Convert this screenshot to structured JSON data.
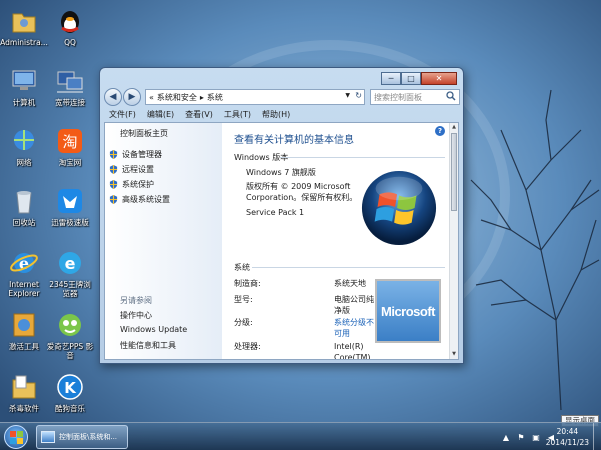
{
  "desktop": {
    "icons": [
      {
        "label": "Administra...",
        "icon": "user-folder-icon"
      },
      {
        "label": "QQ",
        "icon": "qq-penguin-icon"
      },
      {
        "label": "计算机",
        "icon": "computer-icon"
      },
      {
        "label": "宽带连接",
        "icon": "broadband-connection-icon"
      },
      {
        "label": "网络",
        "icon": "network-icon"
      },
      {
        "label": "淘宝网",
        "icon": "taobao-icon"
      },
      {
        "label": "回收站",
        "icon": "recycle-bin-icon"
      },
      {
        "label": "迅雷极速版",
        "icon": "xunlei-icon"
      },
      {
        "label": "Internet\nExplorer",
        "icon": "internet-explorer-icon"
      },
      {
        "label": "2345王牌浏\n览器",
        "icon": "browser-2345-icon"
      },
      {
        "label": "激活工具",
        "icon": "activation-tool-icon"
      },
      {
        "label": "爱奇艺PPS 影\n音",
        "icon": "iqiyi-pps-icon"
      },
      {
        "label": "杀毒软件",
        "icon": "antivirus-folder-icon"
      },
      {
        "label": "酷狗音乐",
        "icon": "kugou-music-icon"
      }
    ]
  },
  "window": {
    "caption_buttons": {
      "minimize": "─",
      "maximize": "□",
      "close": "✕"
    },
    "nav": {
      "back": "◀",
      "forward": "▶"
    },
    "address": {
      "prefix": "«",
      "crumb1": "系统和安全",
      "sep": "▸",
      "crumb2": "系统",
      "dropdown": "▼",
      "refresh": "↻"
    },
    "search_placeholder": "搜索控制面板",
    "menu": [
      "文件(F)",
      "编辑(E)",
      "查看(V)",
      "工具(T)",
      "帮助(H)"
    ],
    "left_panel": {
      "home": "控制面板主页",
      "tasks": [
        "设备管理器",
        "远程设置",
        "系统保护",
        "高级系统设置"
      ],
      "see_also_title": "另请参阅",
      "see_also": [
        "操作中心",
        "Windows Update",
        "性能信息和工具"
      ]
    },
    "main": {
      "help": "?",
      "title": "查看有关计算机的基本信息",
      "edition_header": "Windows 版本",
      "edition": "Windows 7 旗舰版",
      "copyright": "版权所有 © 2009 Microsoft\nCorporation。保留所有权利。",
      "service_pack": "Service Pack 1",
      "system_header": "系统",
      "rows": [
        {
          "label": "制造商:",
          "value": "系统天地"
        },
        {
          "label": "型号:",
          "value": "电脑公司纯\n净版"
        },
        {
          "label": "分级:",
          "value": "系统分级不\n可用"
        },
        {
          "label": "处理器:",
          "value": "Intel(R)\nCore(TM)"
        }
      ],
      "oem_logo_text": "Microsoft"
    }
  },
  "taskbar": {
    "active_task": "控制面板\\系统和...",
    "time": "20:44",
    "date": "2014/11/23",
    "show_desktop_tooltip": "显示桌面"
  }
}
